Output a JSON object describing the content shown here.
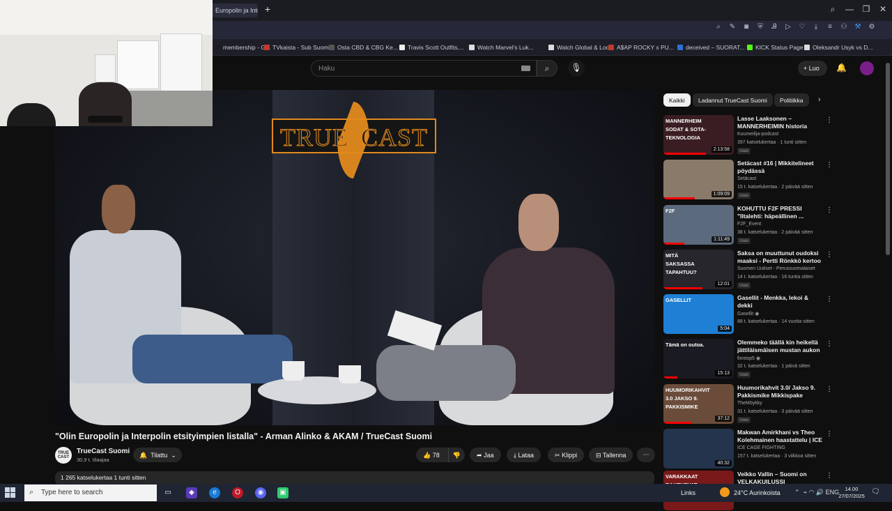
{
  "browser": {
    "tab_title": "Europolin ja Inte",
    "new_tab": "+",
    "bookmarks": [
      {
        "label": "membership - G...",
        "color": "#1a1c25"
      },
      {
        "label": "TVkaista - Sub Suomi",
        "color": "#c0392b"
      },
      {
        "label": "Osta CBD & CBG Ke...",
        "color": "#555555"
      },
      {
        "label": "Travis Scott Outfits,...",
        "color": "#eeeeee"
      },
      {
        "label": "Watch Marvel's Luk...",
        "color": "#dddddd"
      },
      {
        "label": "Watch Global & Loc...",
        "color": "#dddddd"
      },
      {
        "label": "A$AP ROCKY x PU...",
        "color": "#c0392b"
      },
      {
        "label": "deceived – SUORAT...",
        "color": "#2e6fd6"
      },
      {
        "label": "KICK Status Page",
        "color": "#53fc18"
      },
      {
        "label": "Oleksandr Usyk vs D...",
        "color": "#dddddd"
      }
    ]
  },
  "header": {
    "search_placeholder": "Haku",
    "create_label": "Luo"
  },
  "video": {
    "logo_left": "TRUE",
    "logo_right": "CAST",
    "title": "\"Olin Europolin ja Interpolin etsityimpien listalla\" - Arman Alinko & AKAM / TrueCast Suomi",
    "channel_avatar_text": "TRUE CAST",
    "channel_name": "TrueCast Suomi",
    "channel_subs": "30,9 t. tilaajaa",
    "subscribe_label": "Tilattu",
    "likes": "78",
    "share_label": "Jaa",
    "download_label": "Lataa",
    "clip_label": "Klippi",
    "save_label": "Tallenna",
    "description_meta": "1 265 katselukertaa  1 tunti sitten"
  },
  "sidebar": {
    "chips": [
      "Kaikki",
      "Ladannut TrueCast Suomi",
      "Politiikka"
    ],
    "items": [
      {
        "title": "Lasse Laaksonen – MANNERHEIMIN historia",
        "channel": "Kuumeilija-podcast",
        "meta": "397 katselukertaa · 1 tunti sitten",
        "badge": "Uusi",
        "duration": "2:13:58",
        "thumb_color": "#3a1d22",
        "thumb_text": "MANNERHEIM SODAT & SOTA-TEKNOLOGIA"
      },
      {
        "title": "Setäcast #16 | Mikkitelineet pöydässä",
        "channel": "Setäcast",
        "meta": "15 t. katselukertaa · 2 päivää sitten",
        "badge": "Uusi",
        "duration": "1:09:09",
        "thumb_color": "#8a7a6a",
        "thumb_text": ""
      },
      {
        "title": "KOHUTTU F2F PRESSI \"Iltalehti: häpeällinen ...",
        "channel": "F2F_Event",
        "meta": "38 t. katselukertaa · 2 päivää sitten",
        "badge": "Uusi",
        "duration": "1:11:49",
        "thumb_color": "#5b6a7c",
        "thumb_text": "F2F"
      },
      {
        "title": "Saksa on muuttunut oudoksi maaksi - Pertti Rönkkö kertoo ...",
        "channel": "Suomen Uutiset - Perussuomalaiset",
        "meta": "14 t. katselukertaa · 16 tuntia sitten",
        "badge": "Uusi",
        "duration": "12:01",
        "thumb_color": "#26262c",
        "thumb_text": "MITÄ SAKSASSA TAPAHTUU?"
      },
      {
        "title": "Gasellit - Menkka, lekoi & dekki",
        "channel": "Gasellit ◉",
        "meta": "88 t. katselukertaa · 14 vuotta sitten",
        "badge": "",
        "duration": "5:04",
        "thumb_color": "#1e7fd4",
        "thumb_text": "GASELLIT"
      },
      {
        "title": "Olemmeko täällä kin heikellä jättiläismäisen mustan aukon ...",
        "channel": "finntop5 ◉",
        "meta": "32 t. katselukertaa · 1 päivä sitten",
        "badge": "Uusi",
        "duration": "15:13",
        "thumb_color": "#1a1a22",
        "thumb_text": "Tämä on outoa."
      },
      {
        "title": "Huumorikahvit 3.0/ Jakso 9. Pakkismike Mikkispake",
        "channel": "TheMöykky",
        "meta": "31 t. katselukertaa · 3 päivää sitten",
        "badge": "Uusi",
        "duration": "37:12",
        "thumb_color": "#6b4c3a",
        "thumb_text": "HUUMORIKAHVIT 3.0 JAKSO 9. PAKKISMIKE"
      },
      {
        "title": "Makwan Amirkhani vs Theo Kolehmainen haastattelu | ICE ...",
        "channel": "ICE CAGE FIGHTING",
        "meta": "157 t. katselukertaa · 3 viikkoa sitten",
        "badge": "",
        "duration": "40:32",
        "thumb_color": "#24344d",
        "thumb_text": ""
      },
      {
        "title": "Veikko Vallin – Suomi on VELKAKUILUSSI",
        "channel": "",
        "meta": "",
        "badge": "",
        "duration": "",
        "thumb_color": "#7a1919",
        "thumb_text": "VARAKKAAT RAKENEVAT"
      }
    ]
  },
  "taskbar": {
    "search_placeholder": "Type here to search",
    "links": "Links",
    "weather": "24°C  Aurinkoista",
    "lang": "ENG",
    "time": "14.00",
    "date": "27/07/2025"
  }
}
